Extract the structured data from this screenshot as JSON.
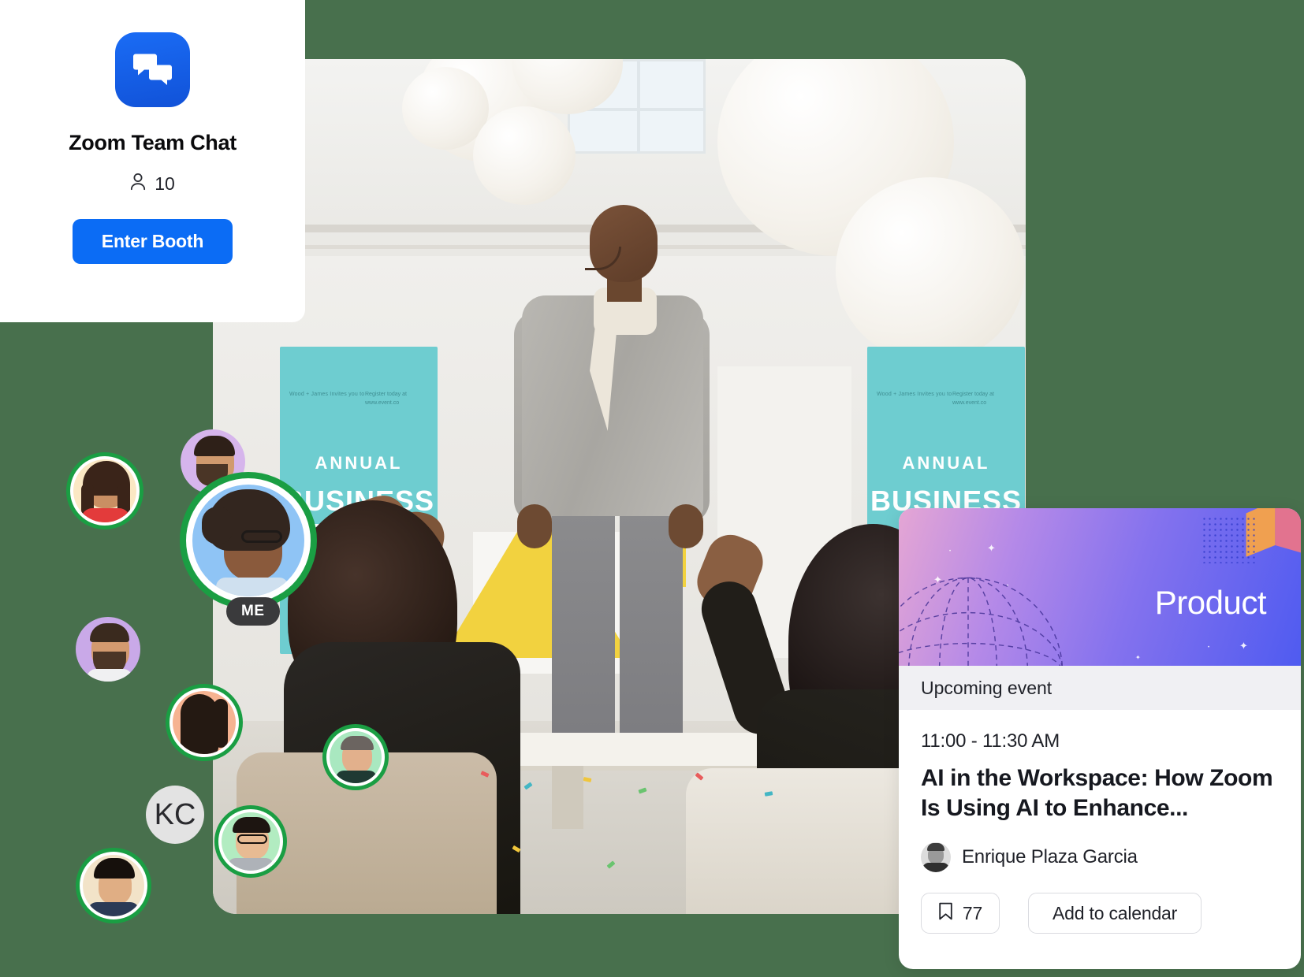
{
  "background": {
    "color": "#48704d"
  },
  "booth_card": {
    "name": "Zoom Team Chat",
    "logo_icon": "chat-bubbles-icon",
    "participant_icon": "person-icon",
    "participant_count": "10",
    "enter_label": "Enter Booth",
    "accent_color": "#0b6cf5"
  },
  "stage": {
    "banner_left": {
      "annual": "ANNUAL",
      "big": "BUSINESS EVENT",
      "small_left": "Wood + James\nInvites you to",
      "small_right": "Register today at\nwww.event.co"
    },
    "banner_right": {
      "annual": "ANNUAL",
      "big": "BUSINESS",
      "small_left": "Wood + James\nInvites you to",
      "small_right": "Register today at\nwww.event.co"
    }
  },
  "participants": [
    {
      "id": "p1",
      "name": "participant-1",
      "speaking": true,
      "type": "photo"
    },
    {
      "id": "p2",
      "name": "participant-2",
      "speaking": false,
      "type": "photo"
    },
    {
      "id": "p3",
      "name": "participant-me",
      "speaking": true,
      "type": "photo",
      "badge": "ME"
    },
    {
      "id": "p4",
      "name": "participant-4",
      "speaking": false,
      "type": "photo"
    },
    {
      "id": "p5",
      "name": "participant-5",
      "speaking": true,
      "type": "photo"
    },
    {
      "id": "p6",
      "name": "participant-6",
      "speaking": false,
      "type": "photo"
    },
    {
      "id": "p7",
      "name": "participant-kc",
      "speaking": false,
      "type": "initials",
      "initials": "KC"
    },
    {
      "id": "p8",
      "name": "participant-8",
      "speaking": true,
      "type": "photo"
    },
    {
      "id": "p9",
      "name": "participant-9",
      "speaking": true,
      "type": "photo"
    }
  ],
  "self_badge": "ME",
  "speaking_ring_color": "#1a9e43",
  "event_card": {
    "hero_category": "Product",
    "band_label": "Upcoming event",
    "time": "11:00 - 11:30 AM",
    "title": "AI in the Workspace: How Zoom Is Using AI to Enhance...",
    "speaker": "Enrique Plaza Garcia",
    "save_icon": "bookmark-icon",
    "save_count": "77",
    "add_to_calendar_label": "Add to calendar",
    "gradient_from": "#e5a6d4",
    "gradient_to": "#4f5bf0"
  }
}
